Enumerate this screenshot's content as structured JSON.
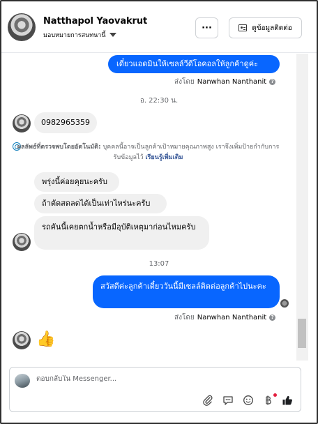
{
  "header": {
    "name": "Natthapol Yaovakrut",
    "subtitle": "มอบหมายการสนทนานี้",
    "more_label": "···",
    "contact_label": "ดูข้อมูลติดต่อ"
  },
  "messages": {
    "out_top": "เดี๋ยวแอดมินให้เซลล์วีดีโอคอลให้ลูกค้าดูค่ะ",
    "sent_by_label": "ส่งโดย",
    "sent_by_name": "Nanwhan Nanthanit",
    "timestamp_1": "อ. 22:30 น.",
    "phone": "0982965359",
    "ai_label": "ผลลัพธ์ที่ตรวจพบโดยอัตโนมัติ:",
    "ai_text": "บุคคลนี้อาจเป็นลูกค้าเป้าหมายคุณภาพสูง เราจึงเพิ่มป้ายกำกับการรับข้อมูลไว้",
    "ai_link": "เรียนรู้เพิ่มเติม",
    "in_1": "พรุ่งนี้ค่อยคุยนะครับ",
    "in_2": "ถ้าตัดสดลดได้เป็นเท่าไหร่นะครับ",
    "in_3": "รถคันนี้เคยตกน้ำหรือมีอุบัติเหตุมาก่อนไหมครับ",
    "timestamp_2": "13:07",
    "out_bottom": "สวัสดีค่ะลูกค้าเดี๋ยววันนี้มีเซลล์ติดต่อลูกค้าไปนะคะ",
    "sent_by_label_2": "ส่งโดย",
    "sent_by_name_2": "Nanwhan Nanthanit",
    "thumbs": "👍"
  },
  "composer": {
    "placeholder": "ตอบกลับใน Messenger..."
  },
  "colors": {
    "accent": "#0866ff",
    "incoming_bubble": "#f0f0f0"
  }
}
